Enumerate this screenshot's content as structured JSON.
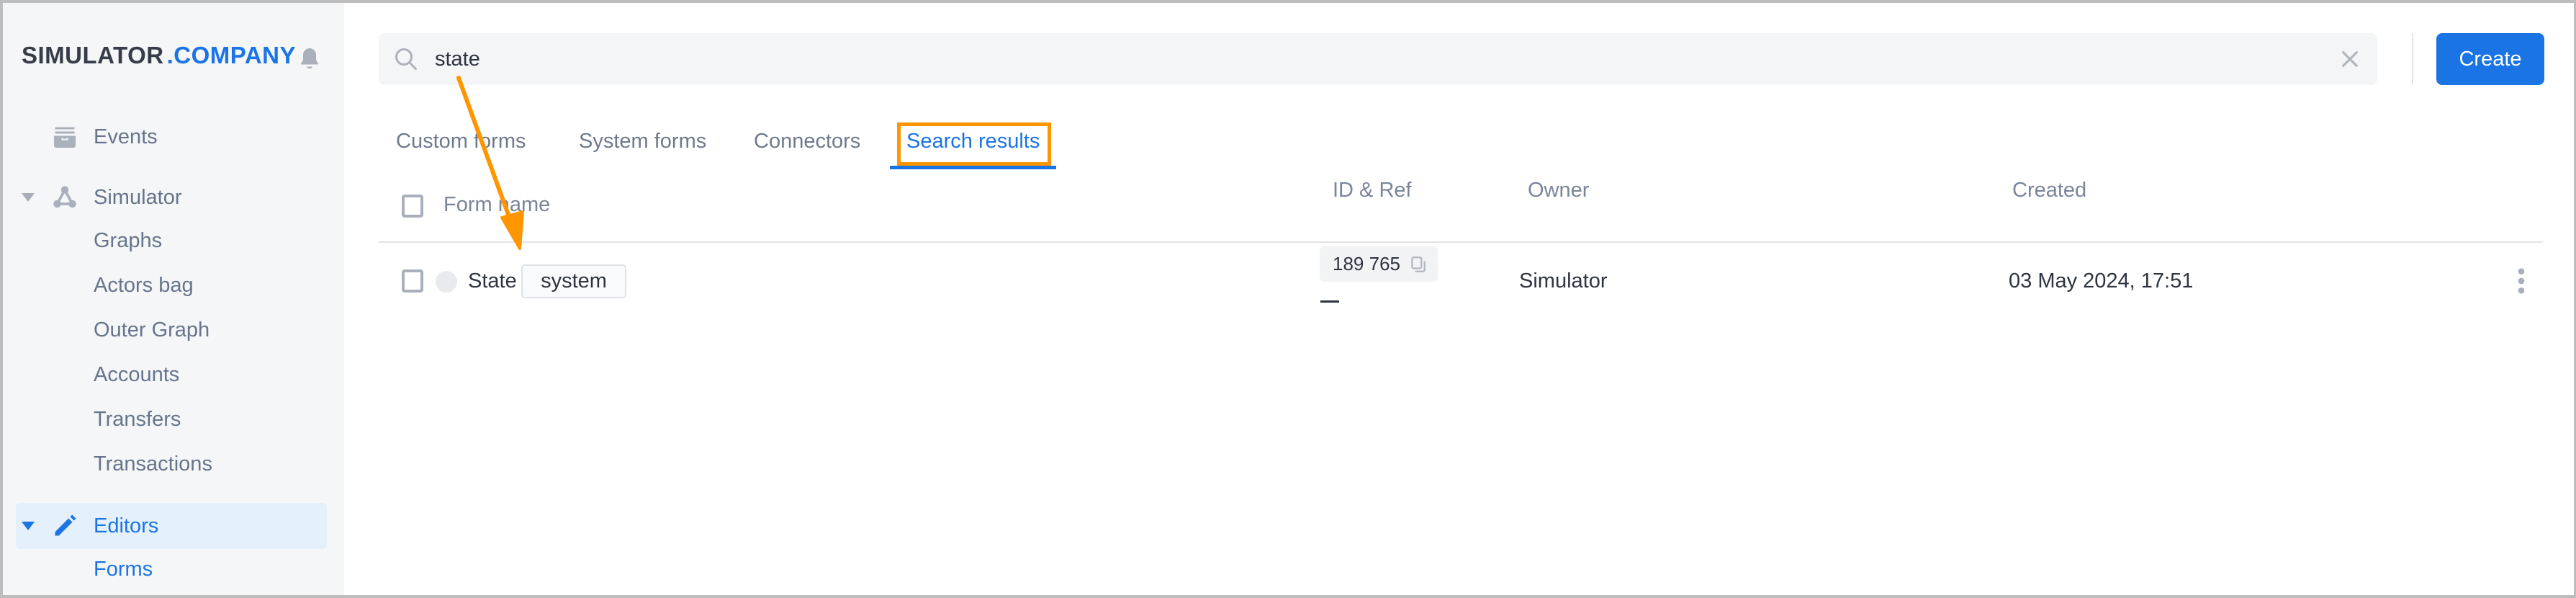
{
  "brand": {
    "part1": "SIMULATOR",
    "part2": ".COMPANY",
    "accent_color": "#1b74e4"
  },
  "sidebar": {
    "items": [
      {
        "label": "Events",
        "icon": "archive-icon",
        "expandable": false
      },
      {
        "label": "Simulator",
        "icon": "graph-nodes-icon",
        "expandable": true,
        "expanded": true,
        "children": [
          "Graphs",
          "Actors bag",
          "Outer Graph",
          "Accounts",
          "Transfers",
          "Transactions"
        ]
      },
      {
        "label": "Editors",
        "icon": "pencil-icon",
        "expandable": true,
        "expanded": true,
        "active": true,
        "children": [
          "Forms"
        ]
      }
    ]
  },
  "search": {
    "value": "state",
    "placeholder": ""
  },
  "toolbar": {
    "create_label": "Create"
  },
  "tabs": [
    {
      "label": "Custom forms",
      "active": false
    },
    {
      "label": "System forms",
      "active": false
    },
    {
      "label": "Connectors",
      "active": false
    },
    {
      "label": "Search results",
      "active": true
    }
  ],
  "table": {
    "columns": [
      "Form name",
      "ID & Ref",
      "Owner",
      "Created"
    ],
    "rows": [
      {
        "name": "State",
        "tag": "system",
        "id": "189 765",
        "ref": "—",
        "owner": "Simulator",
        "created": "03 May 2024, 17:51"
      }
    ]
  },
  "annotation": {
    "color": "#ff9600",
    "highlighted_tab": "Search results"
  }
}
